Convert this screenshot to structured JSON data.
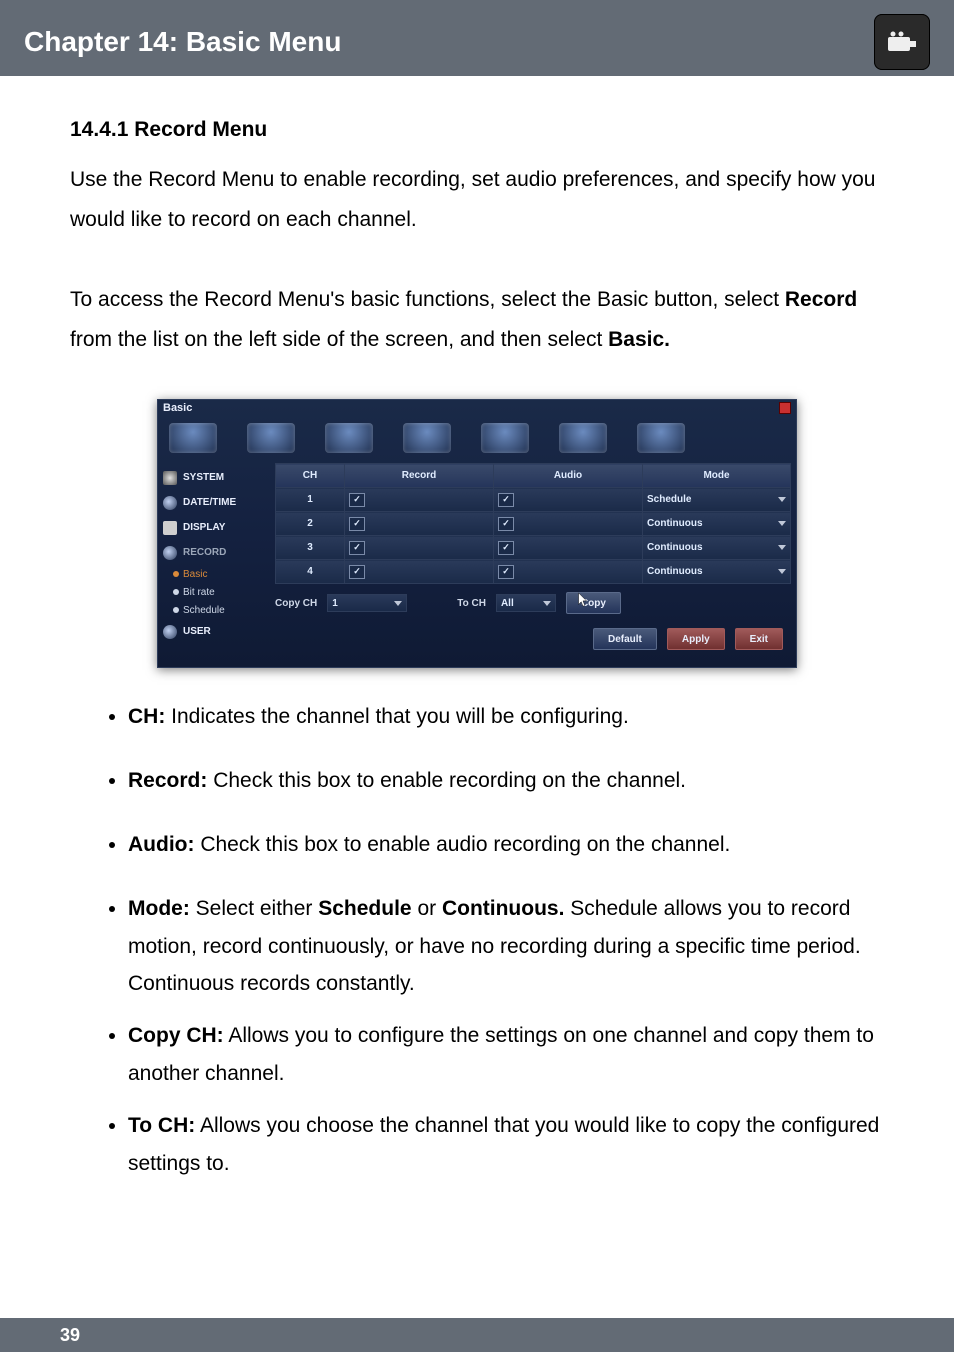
{
  "header": {
    "title": "Chapter 14: Basic Menu"
  },
  "footer": {
    "page_number": "39"
  },
  "section": {
    "heading": "14.4.1 Record Menu",
    "para1": "Use the Record Menu to enable recording, set audio preferences, and specify how you would like to record on each channel.",
    "para2_pre": "To access the Record Menu's basic functions, select the Basic button, select ",
    "para2_bold1": "Record",
    "para2_mid": " from the list on the left side of the screen, and then select ",
    "para2_bold2": "Basic."
  },
  "dvr": {
    "title": "Basic",
    "sidebar": {
      "items": [
        {
          "label": "SYSTEM",
          "icon": "gear"
        },
        {
          "label": "DATE/TIME",
          "icon": "clock"
        },
        {
          "label": "DISPLAY",
          "icon": "mon"
        },
        {
          "label": "RECORD",
          "icon": "rec",
          "active": true
        }
      ],
      "subitems": [
        {
          "label": "Basic",
          "selected": true
        },
        {
          "label": "Bit rate",
          "selected": false
        },
        {
          "label": "Schedule",
          "selected": false
        }
      ],
      "last": {
        "label": "USER",
        "icon": "user"
      }
    },
    "table": {
      "headers": {
        "ch": "CH",
        "record": "Record",
        "audio": "Audio",
        "mode": "Mode"
      },
      "rows": [
        {
          "ch": "1",
          "record": true,
          "audio": true,
          "mode": "Schedule"
        },
        {
          "ch": "2",
          "record": true,
          "audio": true,
          "mode": "Continuous"
        },
        {
          "ch": "3",
          "record": true,
          "audio": true,
          "mode": "Continuous"
        },
        {
          "ch": "4",
          "record": true,
          "audio": true,
          "mode": "Continuous"
        }
      ]
    },
    "copyrow": {
      "copy_ch_label": "Copy CH",
      "copy_ch_value": "1",
      "to_ch_label": "To CH",
      "to_ch_value": "All",
      "copy_btn": "Copy"
    },
    "buttons": {
      "default": "Default",
      "apply": "Apply",
      "exit": "Exit"
    }
  },
  "definitions": [
    {
      "term": "CH:",
      "text": " Indicates the channel that you will be configuring."
    },
    {
      "term": "Record:",
      "text": " Check this box to enable recording on the channel."
    },
    {
      "term": "Audio:",
      "text": " Check this box to enable audio recording on the channel."
    },
    {
      "term": "Mode:",
      "text_pre": " Select either ",
      "b1": "Schedule",
      "mid": " or ",
      "b2": "Continuous.",
      "text_post": " Schedule allows you to record motion, record continuously, or have no recording during a specific time period. Continuous records constantly."
    },
    {
      "term": "Copy CH:",
      "text": " Allows you to configure the settings on one channel and copy them to another channel."
    },
    {
      "term": "To CH:",
      "text": " Allows you choose the channel that you would like to copy the configured settings to."
    }
  ]
}
